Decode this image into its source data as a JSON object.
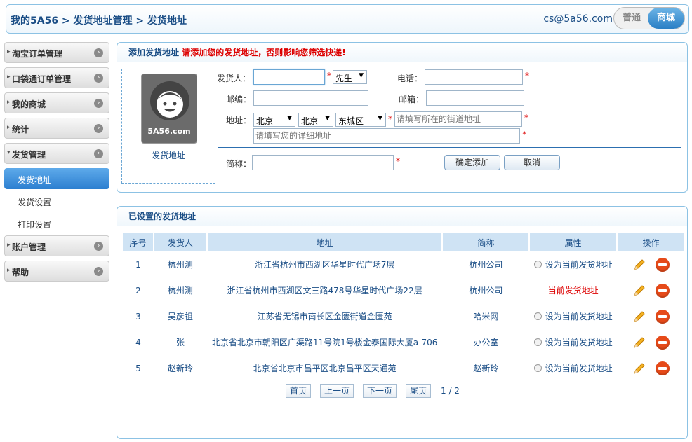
{
  "header": {
    "breadcrumb": "我的5A56 > 发货地址管理 > 发货地址",
    "email": "cs@5a56.com",
    "toggle_normal": "普通",
    "toggle_mall": "商城"
  },
  "sidebar": {
    "menus": [
      {
        "label": "淘宝订单管理"
      },
      {
        "label": "口袋通订单管理"
      },
      {
        "label": "我的商城"
      },
      {
        "label": "统计"
      },
      {
        "label": "发货管理"
      }
    ],
    "sub_items": [
      {
        "label": "发货地址"
      },
      {
        "label": "发货设置"
      },
      {
        "label": "打印设置"
      }
    ],
    "menus_after": [
      {
        "label": "账户管理"
      },
      {
        "label": "帮助"
      }
    ]
  },
  "add_panel": {
    "title": "添加发货地址",
    "warning": "请添加您的发货地址，否则影响您筛选快递!",
    "avatar_logo": "5A56.com",
    "avatar_caption": "发货地址",
    "sender_label": "发货人：",
    "sender_value": "",
    "title_select": "先生",
    "phone_label": "电话：",
    "zip_label": "邮编：",
    "email_label": "邮箱：",
    "address_label": "地址：",
    "province": "北京",
    "city": "北京",
    "district": "东城区",
    "street_placeholder": "请填写所在的街道地址",
    "detail_placeholder": "请填写您的详细地址",
    "alias_label": "简称：",
    "confirm_label": "确定添加",
    "cancel_label": "取消",
    "required_mark": "*"
  },
  "list_panel": {
    "title": "已设置的发货地址",
    "columns": [
      "序号",
      "发货人",
      "地址",
      "简称",
      "属性",
      "操作"
    ],
    "rows": [
      {
        "no": "1",
        "sender": "杭州测",
        "address": "浙江省杭州市西湖区华星时代广场7层",
        "alias": "杭州公司",
        "attr": "设为当前发货地址",
        "current": false
      },
      {
        "no": "2",
        "sender": "杭州测",
        "address": "浙江省杭州市西湖区文三路478号华星时代广场22层",
        "alias": "杭州公司",
        "attr": "当前发货地址",
        "current": true
      },
      {
        "no": "3",
        "sender": "吴彦祖",
        "address": "江苏省无锡市南长区金匮街道金匮苑",
        "alias": "哈米网",
        "attr": "设为当前发货地址",
        "current": false
      },
      {
        "no": "4",
        "sender": "张",
        "address": "北京省北京市朝阳区广渠路11号院1号楼金泰国际大厦a-706",
        "alias": "办公室",
        "attr": "设为当前发货地址",
        "current": false
      },
      {
        "no": "5",
        "sender": "赵新玲",
        "address": "北京省北京市昌平区北京昌平区天通苑",
        "alias": "赵新玲",
        "attr": "设为当前发货地址",
        "current": false
      }
    ],
    "pagination": {
      "first": "首页",
      "prev": "上一页",
      "next": "下一页",
      "last": "尾页",
      "info": "1 / 2"
    }
  },
  "icons": {
    "edit": "pencil-icon",
    "delete": "delete-icon",
    "arrow": "chevron-right-icon"
  },
  "colors": {
    "accent": "#2c7fd0",
    "title": "#1b4e86",
    "warning": "#dd0000",
    "delete": "#e64a19"
  }
}
